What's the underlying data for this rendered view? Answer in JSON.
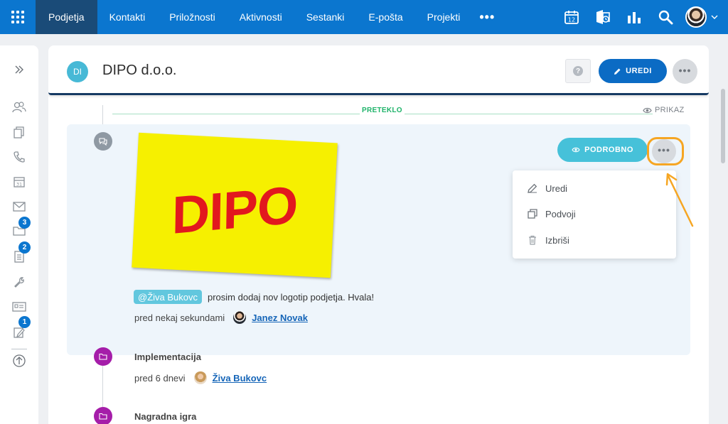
{
  "nav": {
    "items": [
      {
        "label": "Podjetja",
        "active": true
      },
      {
        "label": "Kontakti",
        "active": false
      },
      {
        "label": "Priložnosti",
        "active": false
      },
      {
        "label": "Aktivnosti",
        "active": false
      },
      {
        "label": "Sestanki",
        "active": false
      },
      {
        "label": "E-pošta",
        "active": false
      },
      {
        "label": "Projekti",
        "active": false
      }
    ],
    "more": "•••",
    "calendar_day": "12"
  },
  "sidebar": {
    "badges": {
      "folders": "3",
      "documents": "2",
      "notes": "1"
    }
  },
  "header": {
    "avatar_initials": "DI",
    "title": "DIPO d.o.o.",
    "help": "?",
    "edit_label": "UREDI",
    "more": "•••"
  },
  "timeline": {
    "overdue_label": "PRETEKLO",
    "view_label": "PRIKAZ",
    "card": {
      "logo_text": "DIPO",
      "detail_label": "PODROBNO",
      "more": "•••",
      "menu": [
        {
          "label": "Uredi",
          "icon": "pencil-icon"
        },
        {
          "label": "Podvoji",
          "icon": "duplicate-icon"
        },
        {
          "label": "Izbriši",
          "icon": "trash-icon"
        }
      ],
      "mention": "@Živa Bukovc",
      "comment": "prosim dodaj nov logotip podjetja. Hvala!",
      "time": "pred nekaj sekundami",
      "author": "Janez Novak"
    },
    "entries": [
      {
        "title": "Implementacija",
        "time": "pred 6 dnevi",
        "author": "Živa Bukovc"
      },
      {
        "title": "Nagradna igra"
      }
    ]
  },
  "colors": {
    "primary": "#0b76cf",
    "nav_active": "#1a4b78",
    "accent_cyan": "#46c1d9",
    "highlight": "#f6a623",
    "timeline_purple": "#a51da9",
    "overdue_green": "#1fb36a"
  }
}
